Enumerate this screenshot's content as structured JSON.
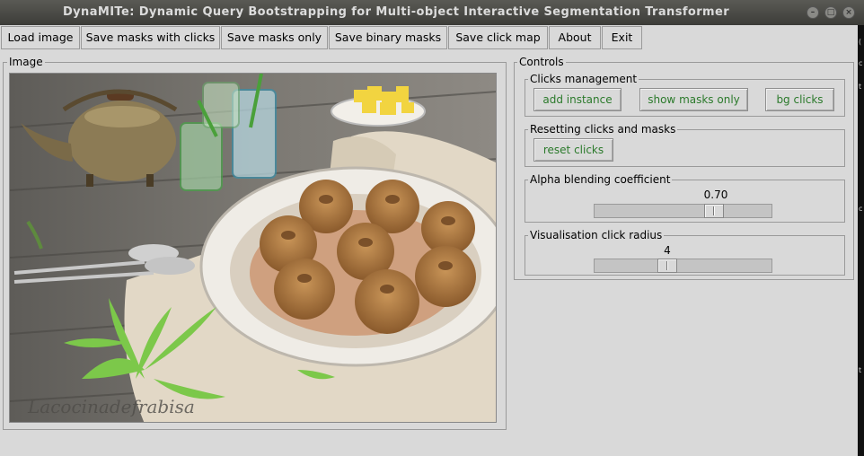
{
  "window": {
    "title": "DynaMITe: Dynamic Query Bootstrapping for Multi-object Interactive Segmentation Transformer"
  },
  "menu": {
    "load_image": "Load image",
    "save_masks_with_clicks": "Save masks with clicks",
    "save_masks_only": "Save masks only",
    "save_binary_masks": "Save binary masks",
    "save_click_map": "Save click map",
    "about": "About",
    "exit": "Exit"
  },
  "image_panel": {
    "label": "Image",
    "watermark": "Lacocinadefrabisa"
  },
  "controls": {
    "label": "Controls",
    "clicks_management": {
      "label": "Clicks management",
      "add_instance": "add instance",
      "show_masks_only": "show masks only",
      "bg_clicks": "bg clicks"
    },
    "resetting": {
      "label": "Resetting clicks and masks",
      "reset_clicks": "reset clicks"
    },
    "alpha": {
      "label": "Alpha blending coefficient",
      "value": "0.70",
      "min": 0,
      "max": 1,
      "level": 0.7
    },
    "click_radius": {
      "label": "Visualisation click radius",
      "value": "4",
      "level": 0.4
    }
  },
  "colors": {
    "button_text": "#2b7a2b",
    "background": "#d9d9d9"
  }
}
